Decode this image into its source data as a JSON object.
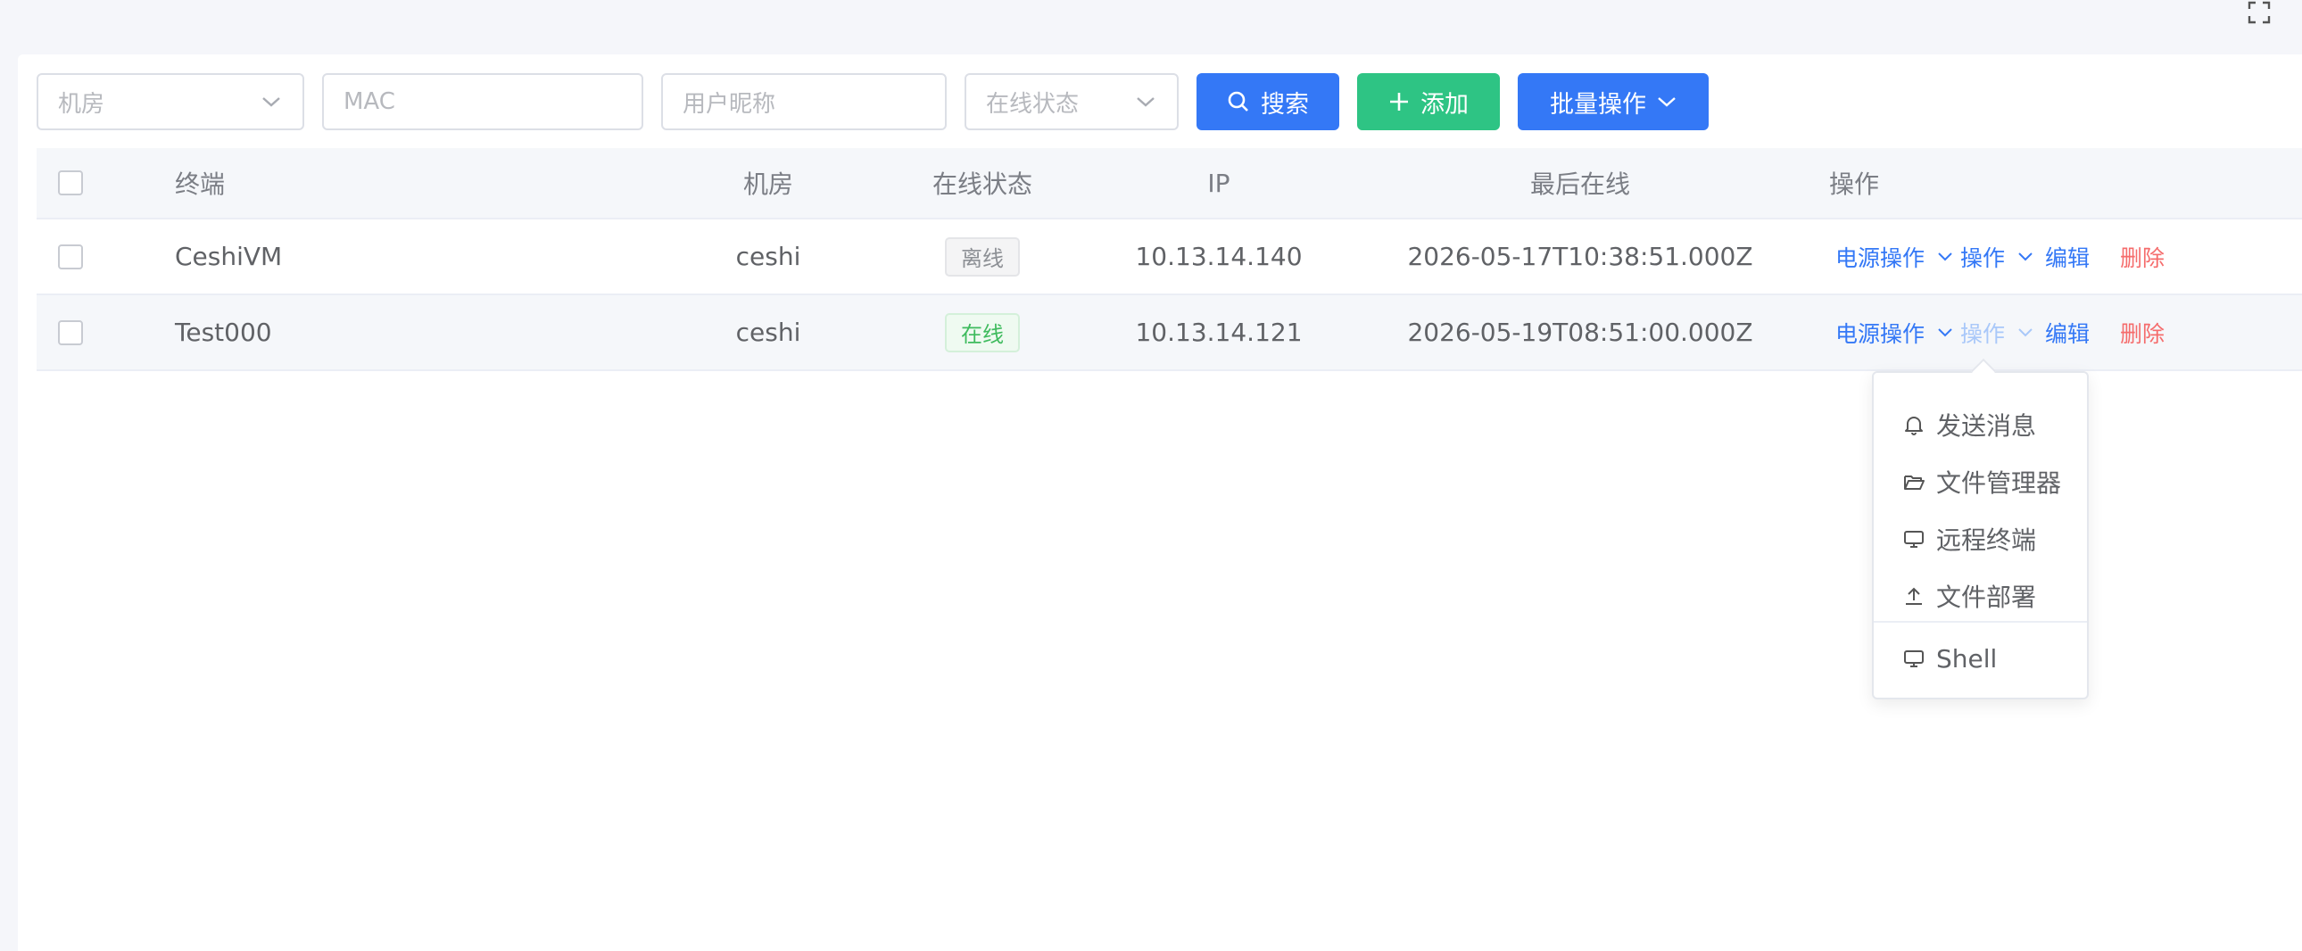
{
  "filters": {
    "room_placeholder": "机房",
    "mac_placeholder": "MAC",
    "nickname_placeholder": "用户昵称",
    "status_placeholder": "在线状态"
  },
  "buttons": {
    "search": "搜索",
    "add": "添加",
    "batch": "批量操作"
  },
  "table": {
    "headers": {
      "terminal": "终端",
      "room": "机房",
      "status": "在线状态",
      "ip": "IP",
      "last_online": "最后在线",
      "actions": "操作"
    },
    "rows": [
      {
        "terminal": "CeshiVM",
        "room": "ceshi",
        "status": "离线",
        "ip": "10.13.14.140",
        "last_online": "2026-05-17T10:38:51.000Z"
      },
      {
        "terminal": "Test000",
        "room": "ceshi",
        "status": "在线",
        "ip": "10.13.14.121",
        "last_online": "2026-05-19T08:51:00.000Z"
      }
    ],
    "row_actions": {
      "power": "电源操作",
      "operate": "操作",
      "edit": "编辑",
      "delete": "删除"
    }
  },
  "dropdown": {
    "items": [
      "发送消息",
      "文件管理器",
      "远程终端",
      "文件部署",
      "Shell"
    ]
  },
  "colors": {
    "primary": "#3478f6",
    "success": "#2ec484",
    "danger": "#f56c6c"
  }
}
